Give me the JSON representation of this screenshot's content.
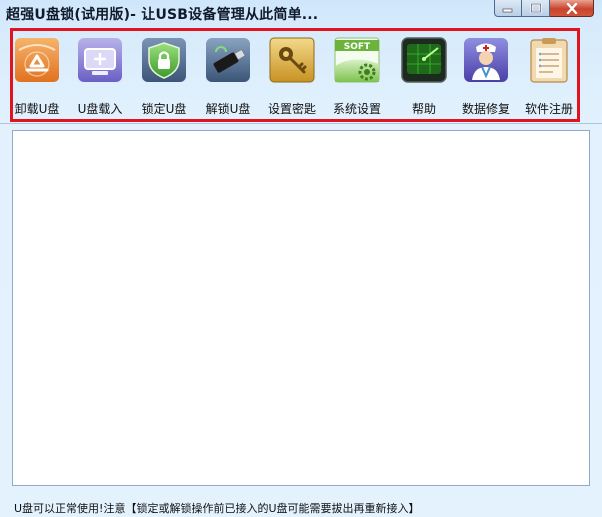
{
  "window": {
    "title": "超强U盘锁(试用版)- 让USB设备管理从此简单...",
    "controls": {
      "minimize_icon": "minimize-icon",
      "maximize_icon": "maximize-icon",
      "close_icon": "close-icon"
    }
  },
  "toolbar": {
    "items": [
      {
        "label": "卸载U盘",
        "icon": "recycle-icon"
      },
      {
        "label": "U盘载入",
        "icon": "usb-load-icon"
      },
      {
        "label": "锁定U盘",
        "icon": "shield-lock-icon"
      },
      {
        "label": "解锁U盘",
        "icon": "usb-drive-icon"
      },
      {
        "label": "设置密匙",
        "icon": "key-icon"
      },
      {
        "label": "系统设置",
        "icon": "soft-gear-icon"
      },
      {
        "label": "帮助",
        "icon": "radar-screen-icon"
      },
      {
        "label": "数据修复",
        "icon": "doctor-icon"
      },
      {
        "label": "软件注册",
        "icon": "clipboard-icon"
      }
    ]
  },
  "status": {
    "text": "U盘可以正常使用!注意【锁定或解锁操作前已接入的U盘可能需要拔出再重新接入】"
  },
  "colors": {
    "highlight_frame": "#e0141e",
    "accent": "#2f7fd1",
    "close_button": "#c8452c"
  }
}
